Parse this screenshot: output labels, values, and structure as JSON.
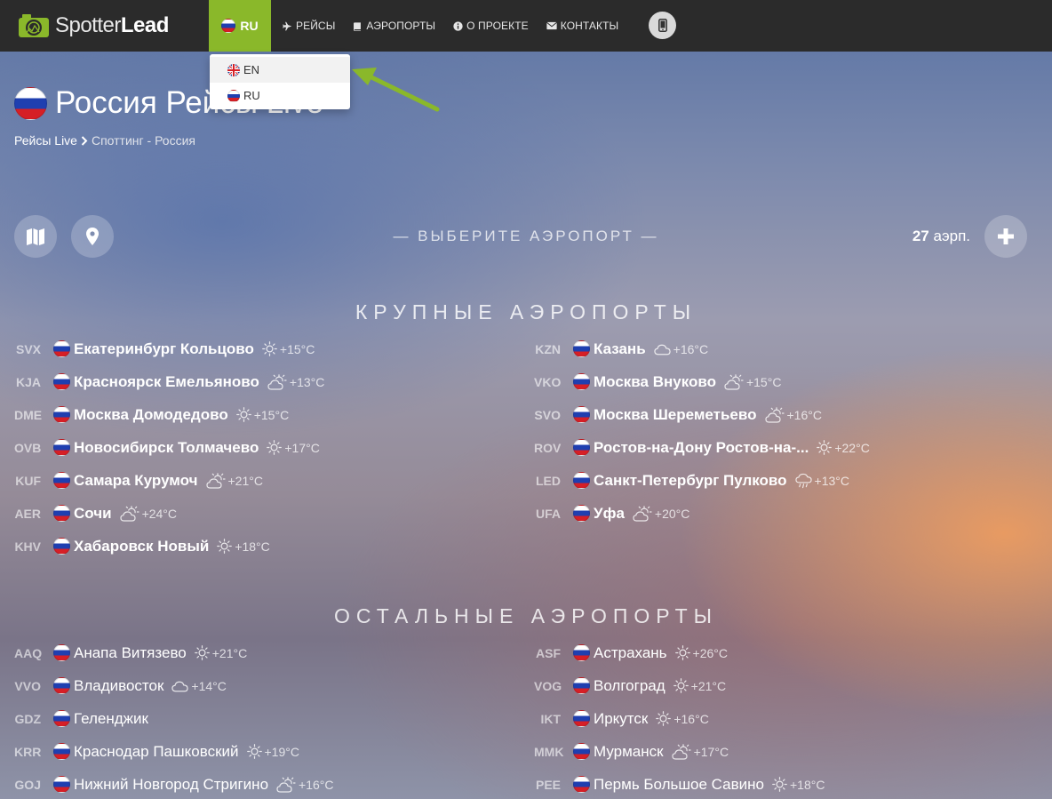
{
  "nav": {
    "logo_light": "Spotter",
    "logo_bold": "Lead",
    "lang_current": "RU",
    "links": [
      {
        "label": "РЕЙСЫ",
        "icon": "plane-icon"
      },
      {
        "label": "АЭРОПОРТЫ",
        "icon": "book-icon"
      },
      {
        "label": "О ПРОЕКТЕ",
        "icon": "info-icon"
      },
      {
        "label": "КОНТАКТЫ",
        "icon": "envelope-icon"
      }
    ],
    "phone_icon": "mobile-phone-icon"
  },
  "lang_dropdown": {
    "items": [
      {
        "label": "EN",
        "flag": "gb"
      },
      {
        "label": "RU",
        "flag": "ru"
      }
    ]
  },
  "header": {
    "title": "Россия Рейсы Live",
    "breadcrumb_link": "Рейсы Live",
    "breadcrumb_current": "Споттинг - Россия"
  },
  "toolbar": {
    "select_airport": "— ВЫБЕРИТЕ АЭРОПОРТ —",
    "date_day": "27",
    "date_month": "аэрп."
  },
  "colors": {
    "accent": "#8ab82a",
    "navbar": "#2b2b2b"
  },
  "major": {
    "title": "КРУПНЫЕ АЭРОПОРТЫ",
    "left": [
      {
        "code": "SVX",
        "name": "Екатеринбург Кольцово",
        "weather": "sun",
        "temp": "+15°C"
      },
      {
        "code": "KJA",
        "name": "Красноярск Емельяново",
        "weather": "partly-cloudy",
        "temp": "+13°C"
      },
      {
        "code": "DME",
        "name": "Москва Домодедово",
        "weather": "sun",
        "temp": "+15°C"
      },
      {
        "code": "OVB",
        "name": "Новосибирск Толмачево",
        "weather": "sun",
        "temp": "+17°C"
      },
      {
        "code": "KUF",
        "name": "Самара Курумоч",
        "weather": "partly-cloudy",
        "temp": "+21°C"
      },
      {
        "code": "AER",
        "name": "Сочи",
        "weather": "partly-cloudy",
        "temp": "+24°C"
      },
      {
        "code": "KHV",
        "name": "Хабаровск Новый",
        "weather": "sun",
        "temp": "+18°C"
      }
    ],
    "right": [
      {
        "code": "KZN",
        "name": "Казань",
        "weather": "cloud",
        "temp": "+16°C"
      },
      {
        "code": "VKO",
        "name": "Москва Внуково",
        "weather": "partly-cloudy",
        "temp": "+15°C"
      },
      {
        "code": "SVO",
        "name": "Москва Шереметьево",
        "weather": "partly-cloudy",
        "temp": "+16°C"
      },
      {
        "code": "ROV",
        "name": "Ростов-на-Дону Ростов-на-...",
        "weather": "sun",
        "temp": "+22°C"
      },
      {
        "code": "LED",
        "name": "Санкт-Петербург Пулково",
        "weather": "rain",
        "temp": "+13°C"
      },
      {
        "code": "UFA",
        "name": "Уфа",
        "weather": "partly-cloudy",
        "temp": "+20°C"
      }
    ]
  },
  "other": {
    "title": "ОСТАЛЬНЫЕ АЭРОПОРТЫ",
    "left": [
      {
        "code": "AAQ",
        "name": "Анапа Витязево",
        "weather": "sun",
        "temp": "+21°C"
      },
      {
        "code": "VVO",
        "name": "Владивосток",
        "weather": "cloud",
        "temp": "+14°C"
      },
      {
        "code": "GDZ",
        "name": "Геленджик",
        "weather": "",
        "temp": ""
      },
      {
        "code": "KRR",
        "name": "Краснодар Пашковский",
        "weather": "sun",
        "temp": "+19°C"
      },
      {
        "code": "GOJ",
        "name": "Нижний Новгород Стригино",
        "weather": "partly-cloudy",
        "temp": "+16°C"
      }
    ],
    "right": [
      {
        "code": "ASF",
        "name": "Астрахань",
        "weather": "sun",
        "temp": "+26°C"
      },
      {
        "code": "VOG",
        "name": "Волгоград",
        "weather": "sun",
        "temp": "+21°C"
      },
      {
        "code": "IKT",
        "name": "Иркутск",
        "weather": "sun",
        "temp": "+16°C"
      },
      {
        "code": "MMK",
        "name": "Мурманск",
        "weather": "partly-cloudy",
        "temp": "+17°C"
      },
      {
        "code": "PEE",
        "name": "Пермь Большое Савино",
        "weather": "sun",
        "temp": "+18°C"
      }
    ]
  }
}
